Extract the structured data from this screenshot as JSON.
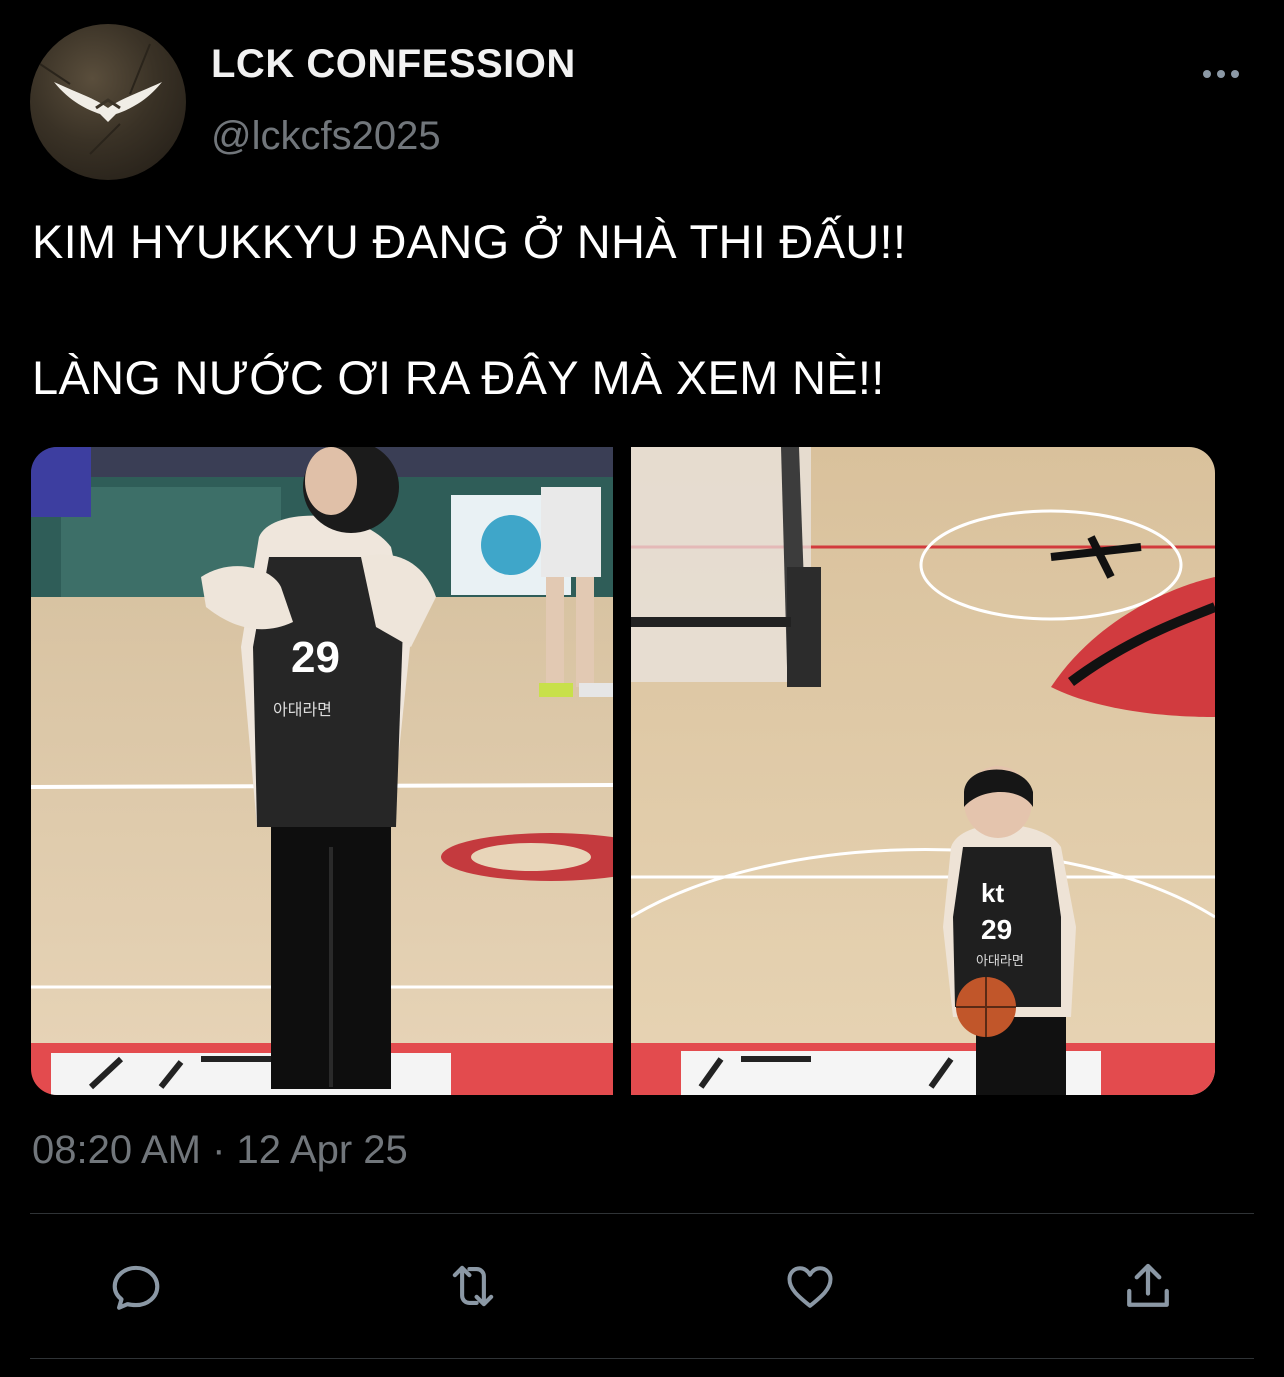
{
  "author": {
    "display_name": "LCK CONFESSION",
    "handle": "@lckcfs2025",
    "avatar_icon": "winged-logo-icon"
  },
  "more_icon": "more-horizontal-icon",
  "tweet": {
    "lines": [
      "KIM HYUKKYU ĐANG Ở NHÀ THI ĐẤU!!",
      "LÀNG NƯỚC ƠI RA ĐÂY MÀ XEM NÈ!!"
    ]
  },
  "media": {
    "photos": [
      {
        "name": "photo-covering-face",
        "jersey_number": "29",
        "jersey_sponsor": "아대라면"
      },
      {
        "name": "photo-holding-basketball",
        "jersey_number": "29",
        "jersey_brand": "kt",
        "jersey_sponsor": "아대라면"
      }
    ]
  },
  "timestamp": "08:20 AM · 12 Apr 25",
  "actions": [
    {
      "name": "reply",
      "icon": "reply-icon"
    },
    {
      "name": "retweet",
      "icon": "retweet-icon"
    },
    {
      "name": "like",
      "icon": "heart-icon"
    },
    {
      "name": "share",
      "icon": "share-icon"
    }
  ],
  "colors": {
    "background": "#000000",
    "text_primary": "#ffffff",
    "text_secondary": "#71767b",
    "icon": "#8b98a5",
    "divider": "#2f3336"
  }
}
